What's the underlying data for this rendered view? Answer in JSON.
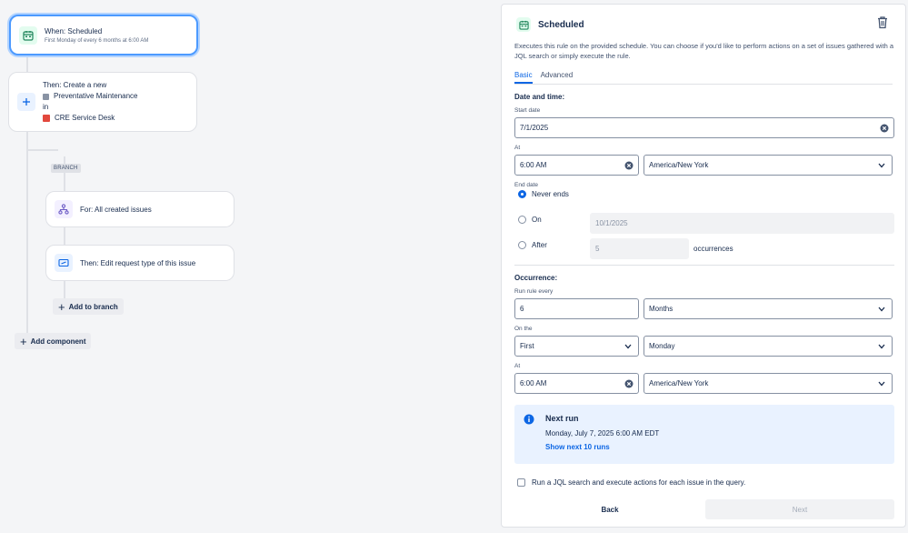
{
  "canvas": {
    "trigger": {
      "title": "When: Scheduled",
      "subtitle": "First Monday of every 6 months at 6:00 AM"
    },
    "action": {
      "title": "Then: Create a new",
      "issue_type": "Preventative Maintenance",
      "in_label": "in",
      "project": "CRE Service Desk"
    },
    "branch_tag": "BRANCH",
    "branch_for": "For: All created issues",
    "branch_then": "Then: Edit request type of this issue",
    "add_to_branch": "Add to branch",
    "add_component": "Add component"
  },
  "panel": {
    "title": "Scheduled",
    "description": "Executes this rule on the provided schedule. You can choose if you'd like to perform actions on a set of issues gathered with a JQL search or simply execute the rule.",
    "tabs": [
      {
        "label": "Basic"
      },
      {
        "label": "Advanced"
      }
    ],
    "date_time_label": "Date and time:",
    "start_date_label": "Start date",
    "start_date_value": "7/1/2025",
    "at_label": "At",
    "start_time_value": "6:00 AM",
    "start_timezone": "America/New York",
    "end_date_label": "End date",
    "never_ends": "Never ends",
    "on_label": "On",
    "on_date_placeholder": "10/1/2025",
    "after_label": "After",
    "after_count_placeholder": "5",
    "occurrences_label": "occurrences",
    "occurrence_label": "Occurrence:",
    "run_every_label": "Run rule every",
    "run_every_value": "6",
    "run_every_unit": "Months",
    "on_the_label": "On the",
    "on_the_ordinal": "First",
    "on_the_day": "Monday",
    "at2_label": "At",
    "occ_time_value": "6:00 AM",
    "occ_timezone": "America/New York",
    "next_run": {
      "title": "Next run",
      "date": "Monday, July 7, 2025 6:00 AM EDT",
      "link": "Show next 10 runs"
    },
    "jql_checkbox_label": "Run a JQL search and execute actions for each issue in the query.",
    "back_label": "Back",
    "next_label": "Next"
  },
  "colors": {
    "accent": "#0c66e4",
    "selected_border": "#4c9aff",
    "info_bg": "#e9f2ff"
  }
}
